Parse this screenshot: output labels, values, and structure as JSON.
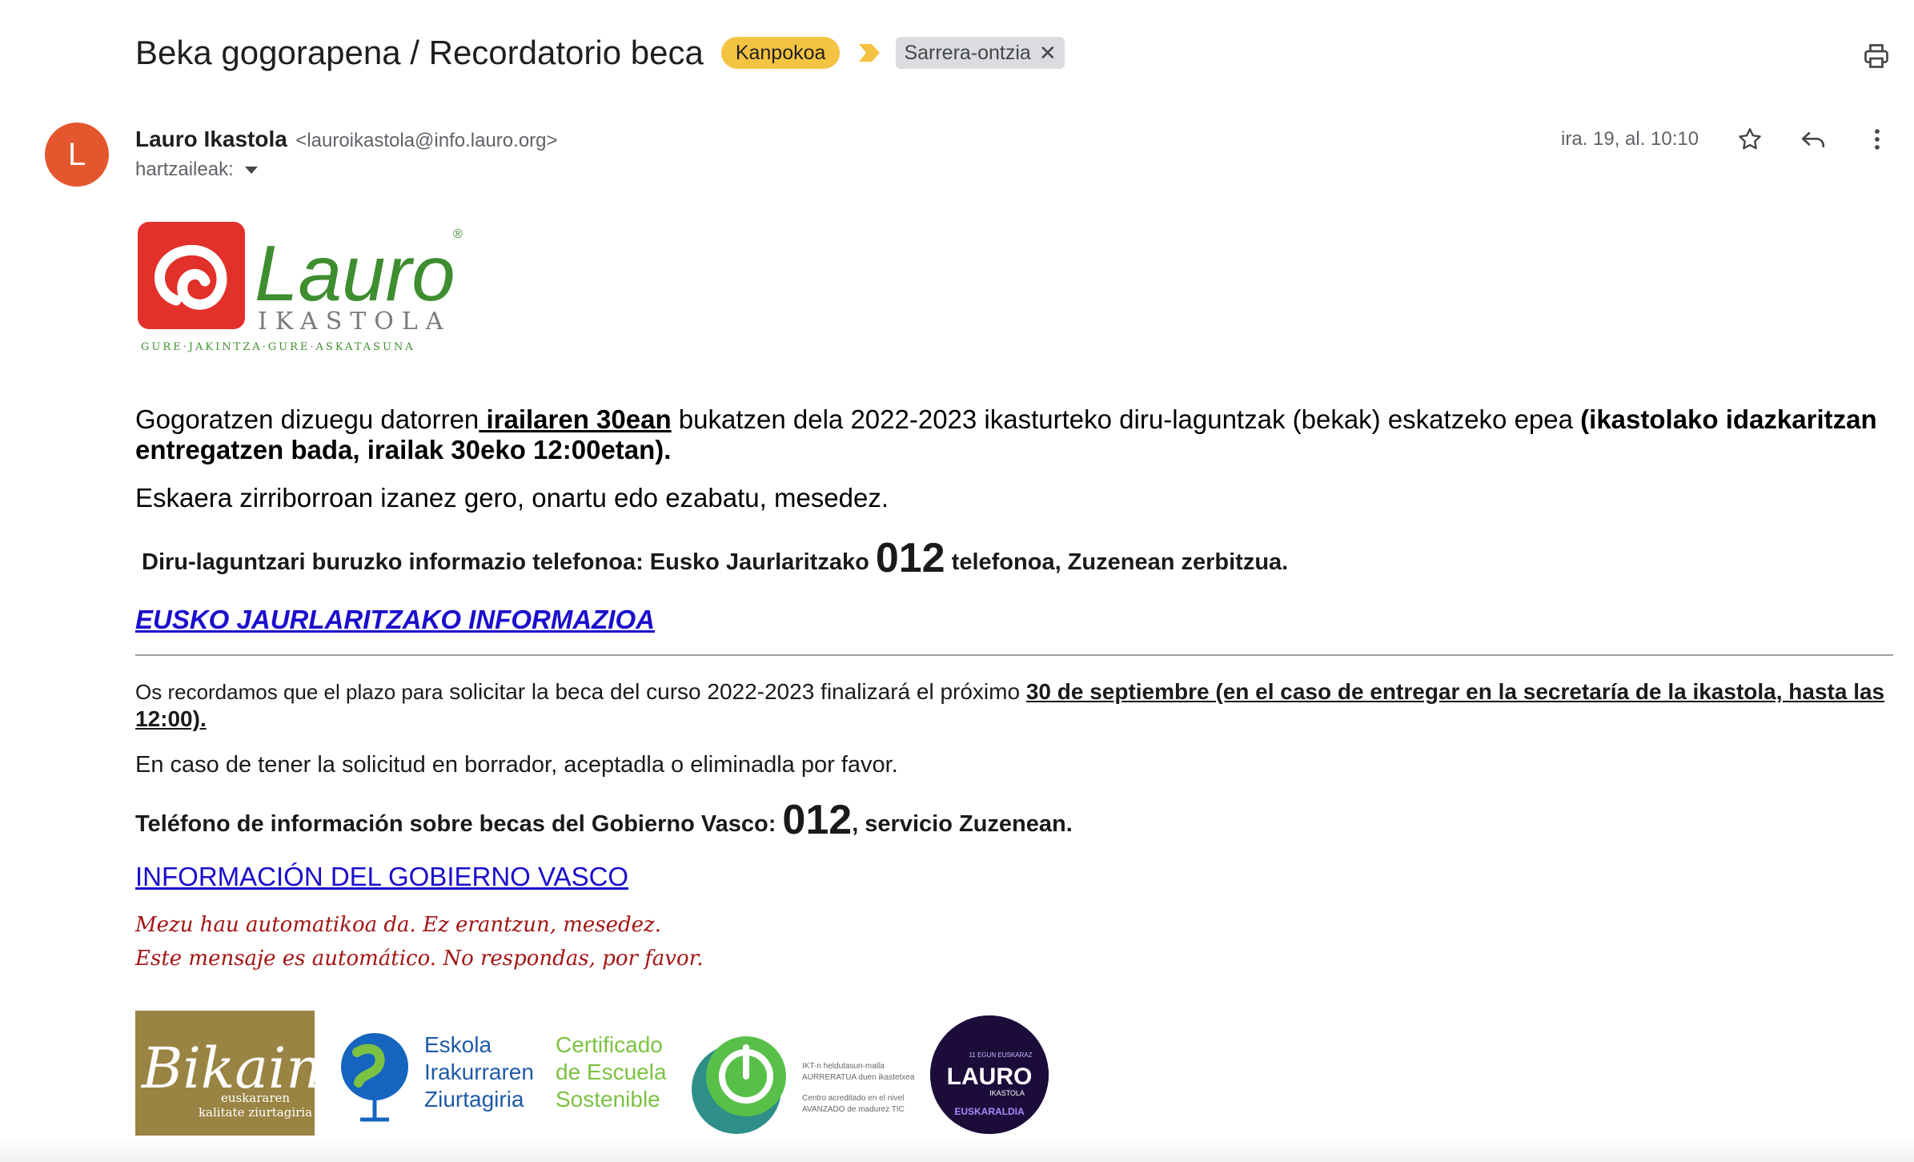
{
  "header": {
    "subject": "Beka gogorapena / Recordatorio beca",
    "external_label": "Kanpokoa",
    "inbox_label": "Sarrera-ontzia"
  },
  "sender": {
    "avatar_letter": "L",
    "name": "Lauro Ikastola",
    "email": "<lauroikastola@info.lauro.org>",
    "recipients_label": "hartzaileak:",
    "date": "ira. 19, al. 10:10"
  },
  "logo": {
    "brand": "Lauro",
    "sub": "IKASTOLA",
    "tagline": "GURE·JAKINTZA·GURE·ASKATASUNA",
    "reg": "®"
  },
  "body": {
    "p1_a": "Gogoratzen dizuegu datorren",
    "p1_b": " irailaren 30ean",
    "p1_c": " bukatzen dela 2022-2023 ikasturteko diru-laguntzak (bekak) eskatzeko epea ",
    "p1_d": "(ikastolako idazkaritzan entregatzen bada, irailak 30eko 12:00etan).",
    "p2": "Eskaera zirriborroan izanez gero, onartu edo ezabatu, mesedez.",
    "p3_a": "Diru-laguntzari buruzko informazio telefonoa: Eusko Jaurlaritzako ",
    "p3_num": "012",
    "p3_b": " telefonoa, Zuzenean zerbitzua.",
    "link_eu": "EUSKO JAURLARITZAKO INFORMAZIOA",
    "p4_a": "Os recordamos que el plazo para",
    "p4_b": " solicitar la beca del curso 2022-2023 finalizará el próximo ",
    "p4_c": "30 de septiembre (en el caso de entregar en la secretaría de la ikastola, hasta las 12:00).",
    "p5": "En caso de tener la solicitud en borrador, aceptadla o eliminadla por favor.",
    "p6_a": "Teléfono de información sobre becas del Gobierno Vasco: ",
    "p6_num": "012",
    "p6_b": ", servicio Zuzenean.",
    "link_es": "INFORMACIÓN DEL GOBIERNO VASCO",
    "auto_eu": "Mezu hau automatikoa da. Ez erantzun, mesedez.",
    "auto_es": "Este mensaje es automático. No respondas, por favor."
  },
  "footer": {
    "bikain_title": "Bikain",
    "bikain_sub1": "euskararen",
    "bikain_sub2": "kalitate ziurtagiria",
    "eskola_l1": "Eskola",
    "eskola_l2": "Irakurraren",
    "eskola_l3": "Ziurtagiria",
    "cert_l1": "Certificado",
    "cert_l2": "de Escuela",
    "cert_l3": "Sostenible",
    "ikt_l1": "IKT-n heldutasun-maila",
    "ikt_l2": "AURRERATUA duen ikastetxea",
    "ikt_l3": "Centro acreditado en el nivel",
    "ikt_l4": "AVANZADO de madurez TIC",
    "eusk_top": "11 EGUN EUSKARAZ",
    "eusk_brand": "LAURO",
    "eusk_sub": "IKASTOLA",
    "eusk_bottom": "EUSKARALDIA"
  },
  "colors": {
    "avatar": "#e4572e",
    "external_badge": "#f5c342",
    "link": "#1a0dcc",
    "auto_text": "#a31515",
    "logo_red": "#e2302a",
    "logo_green": "#3e8d2f"
  }
}
